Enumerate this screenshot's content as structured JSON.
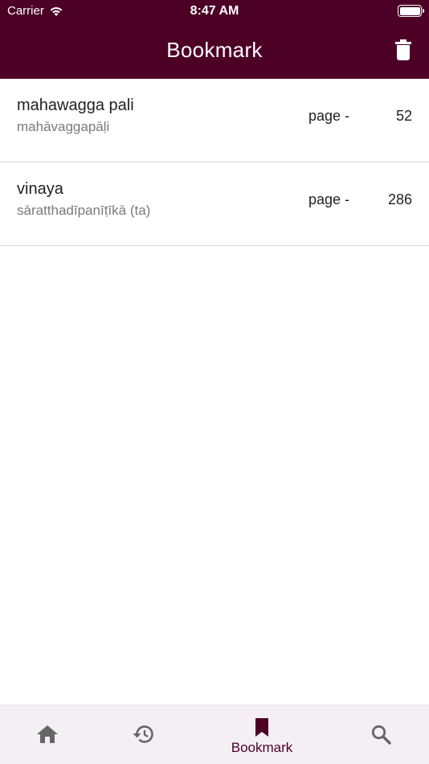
{
  "status_bar": {
    "carrier": "Carrier",
    "time": "8:47 AM"
  },
  "header": {
    "title": "Bookmark"
  },
  "bookmarks": [
    {
      "title": "mahawagga pali",
      "subtitle": "mahāvaggapāḷi",
      "page_label": "page -",
      "page": "52"
    },
    {
      "title": "vinaya",
      "subtitle": "sāratthadīpanīṭīkā (ta)",
      "page_label": "page -",
      "page": "286"
    }
  ],
  "bottom_nav": {
    "active": "Bookmark",
    "items": [
      {
        "icon": "home-icon"
      },
      {
        "icon": "history-icon"
      },
      {
        "icon": "bookmark-icon",
        "label": "Bookmark"
      },
      {
        "icon": "search-icon"
      }
    ]
  },
  "colors": {
    "primary": "#4d0026",
    "nav_background": "#f3eff2",
    "icon_gray": "#666666"
  }
}
